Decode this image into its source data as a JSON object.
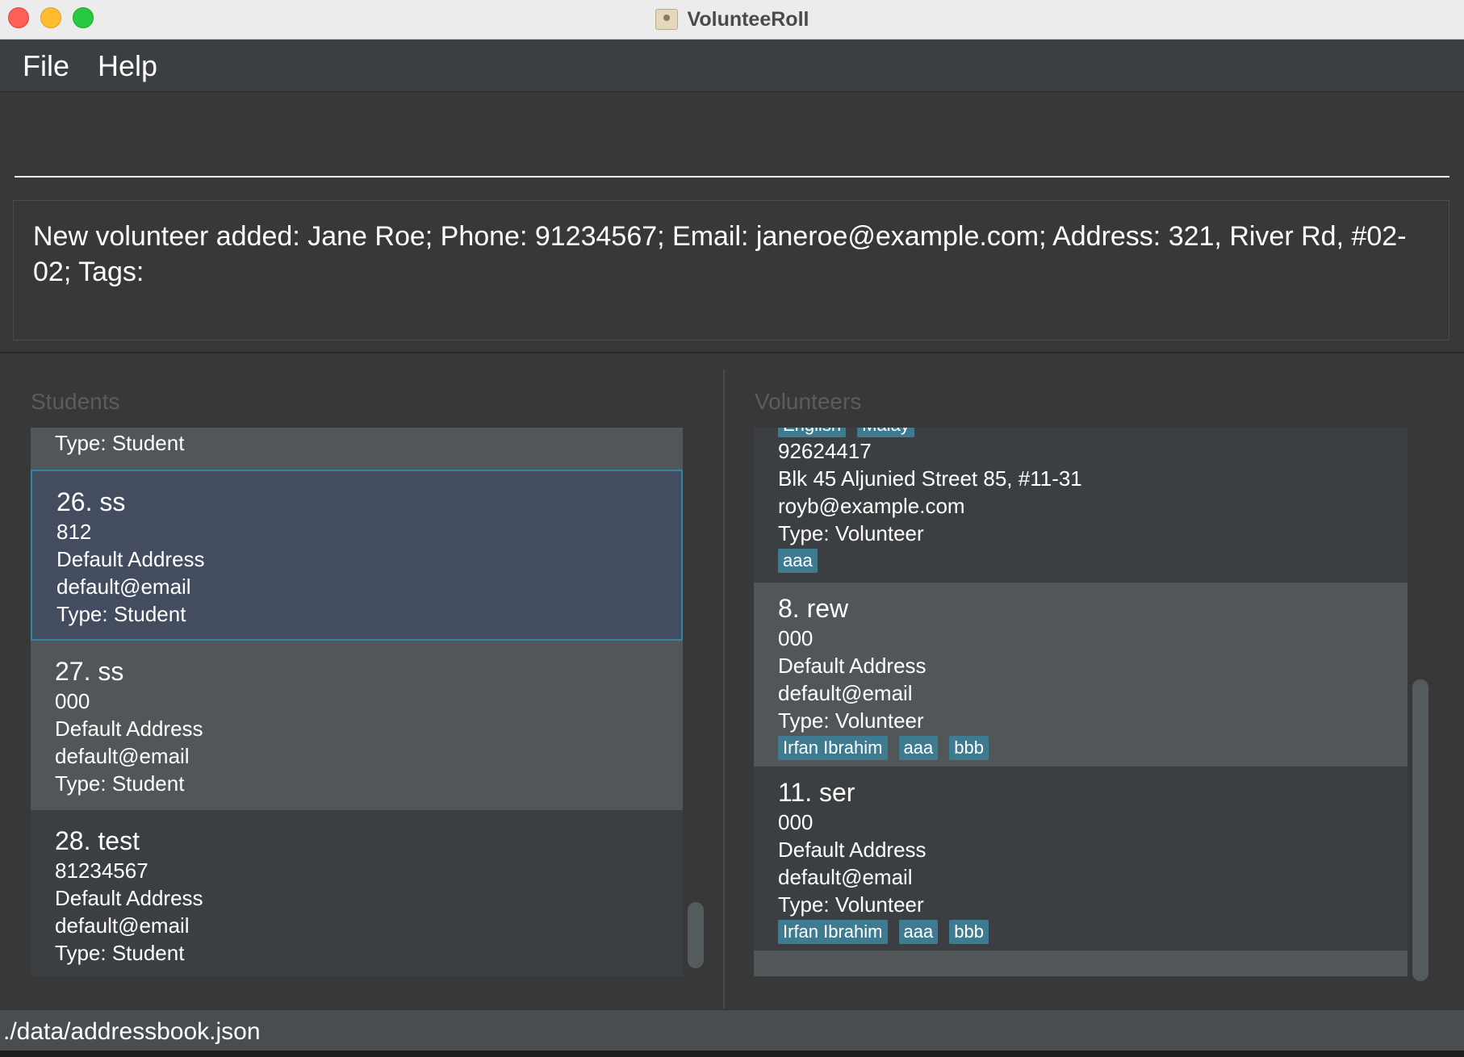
{
  "window": {
    "title": "VolunteeRoll"
  },
  "menu": {
    "file": "File",
    "help": "Help"
  },
  "command": {
    "value": ""
  },
  "result": {
    "message": "New volunteer added: Jane Roe; Phone: 91234567; Email: janeroe@example.com; Address: 321, River Rd, #02-02; Tags:"
  },
  "students": {
    "label": "Students",
    "partial_top": {
      "type": "Type: Student"
    },
    "cards": [
      {
        "name": "26. ss",
        "phone": "812",
        "address": "Default Address",
        "email": "default@email",
        "type": "Type: Student"
      },
      {
        "name": "27. ss",
        "phone": "000",
        "address": "Default Address",
        "email": "default@email",
        "type": "Type: Student"
      },
      {
        "name": "28. test",
        "phone": "81234567",
        "address": "Default Address",
        "email": "default@email",
        "type": "Type: Student"
      }
    ]
  },
  "volunteers": {
    "label": "Volunteers",
    "partial_top": {
      "tags": [
        "English",
        "Malay"
      ],
      "phone": "92624417",
      "address": "Blk 45 Aljunied Street 85, #11-31",
      "email": "royb@example.com",
      "type": "Type: Volunteer",
      "tags2": [
        "aaa"
      ]
    },
    "cards": [
      {
        "name": "8. rew",
        "phone": "000",
        "address": "Default Address",
        "email": "default@email",
        "type": "Type: Volunteer",
        "tags": [
          "Irfan Ibrahim",
          "aaa",
          "bbb"
        ]
      },
      {
        "name": "11. ser",
        "phone": "000",
        "address": "Default Address",
        "email": "default@email",
        "type": "Type: Volunteer",
        "tags": [
          "Irfan Ibrahim",
          "aaa",
          "bbb"
        ]
      }
    ]
  },
  "status": {
    "path": "./data/addressbook.json"
  }
}
